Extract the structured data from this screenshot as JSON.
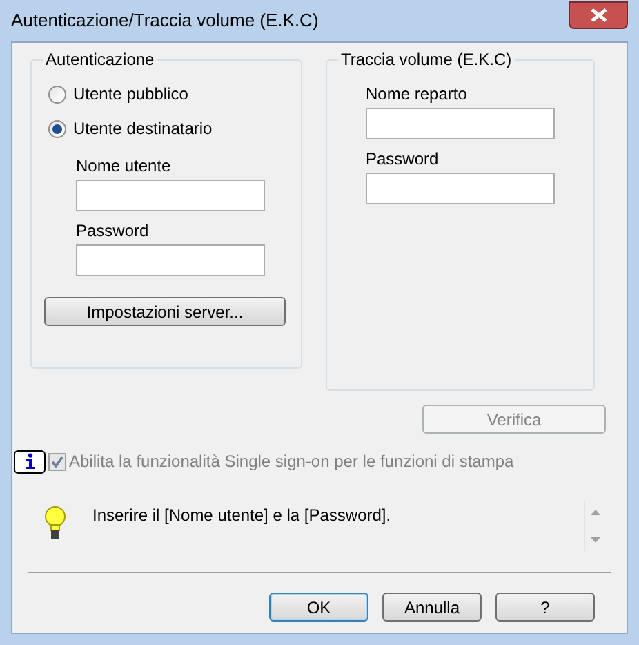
{
  "window": {
    "title": "Autenticazione/Traccia volume (E.K.C)"
  },
  "authentication": {
    "title": "Autenticazione",
    "options": [
      {
        "label": "Utente pubblico",
        "selected": false
      },
      {
        "label": "Utente destinatario",
        "selected": true
      }
    ],
    "fields": [
      {
        "label": "Nome utente"
      },
      {
        "label": "Password"
      }
    ],
    "server_button": "Impostazioni server..."
  },
  "account_track": {
    "title": "Traccia volume (E.K.C)",
    "fields": [
      {
        "label": "Nome reparto"
      },
      {
        "label": "Password"
      }
    ]
  },
  "verify_button": {
    "label": "Verifica",
    "disabled": true
  },
  "single_sign_on": {
    "label": "Abilita la funzionalità Single sign-on per le funzioni di stampa",
    "checked": true,
    "disabled": true
  },
  "hint": "Inserire il [Nome utente] e la [Password].",
  "buttons": [
    {
      "label": "OK",
      "default": true
    },
    {
      "label": "Annulla",
      "default": false
    },
    {
      "label": "?",
      "default": false
    }
  ]
}
